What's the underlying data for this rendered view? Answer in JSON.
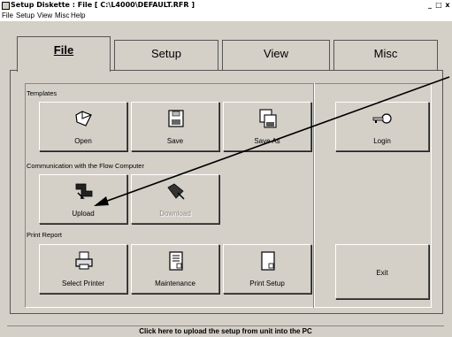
{
  "window": {
    "title": "Setup Diskette : File [ C:\\L4000\\DEFAULT.RFR ]",
    "controls": [
      "_",
      "□",
      "x"
    ]
  },
  "menu": [
    "File",
    "Setup",
    "View",
    "Misc",
    "Help"
  ],
  "tabs": [
    {
      "label": "File",
      "active": true
    },
    {
      "label": "Setup",
      "active": false
    },
    {
      "label": "View",
      "active": false
    },
    {
      "label": "Misc",
      "active": false
    }
  ],
  "sections": {
    "templates": "Templates",
    "communication": "Communication with the Flow Computer",
    "print_report": "Print Report"
  },
  "buttons": {
    "open": {
      "label": "Open",
      "icon": "open-folder-icon"
    },
    "save": {
      "label": "Save",
      "icon": "floppy-disk-icon"
    },
    "save_as": {
      "label": "Save As",
      "icon": "floppy-disks-icon"
    },
    "login": {
      "label": "Login",
      "icon": "key-icon"
    },
    "upload": {
      "label": "Upload",
      "icon": "upload-icon"
    },
    "download": {
      "label": "Download",
      "icon": "download-icon",
      "disabled": true
    },
    "select_printer": {
      "label": "Select Printer",
      "icon": "printer-icon"
    },
    "maintenance": {
      "label": "Maintenance",
      "icon": "maintenance-document-icon"
    },
    "print_setup": {
      "label": "Print Setup",
      "icon": "print-setup-document-icon"
    },
    "exit": {
      "label": "Exit"
    }
  },
  "status": "Click here to upload the setup from unit into the PC"
}
